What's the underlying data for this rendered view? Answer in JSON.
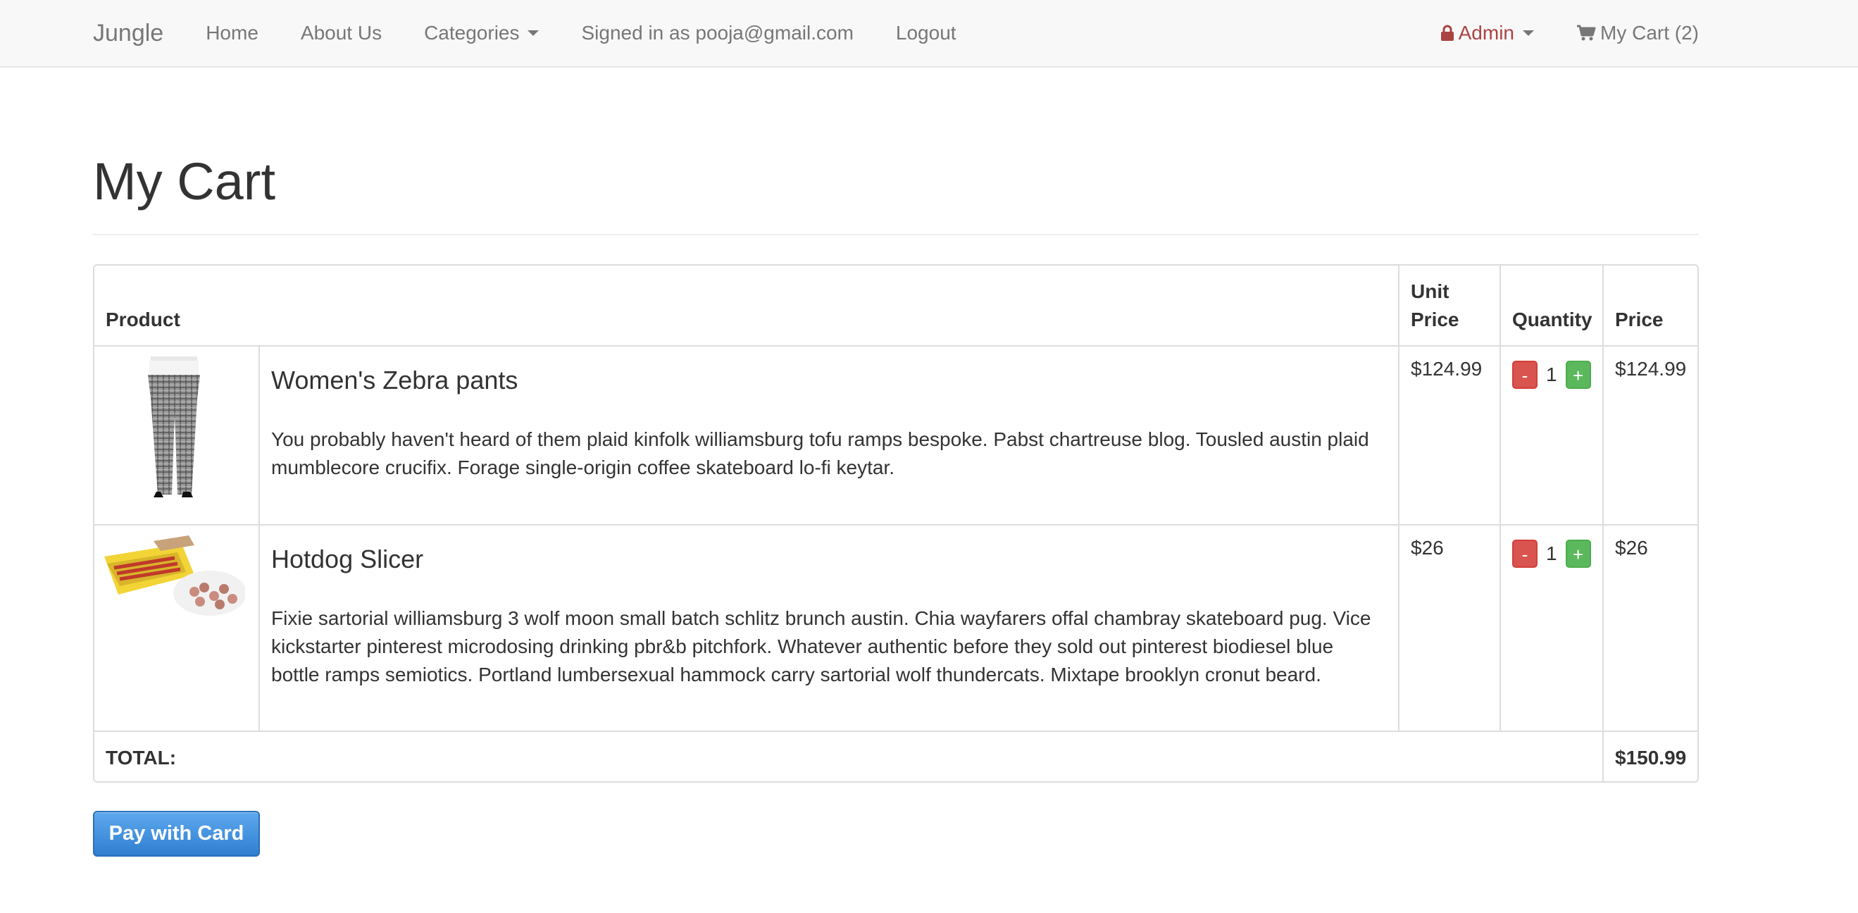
{
  "nav": {
    "brand": "Jungle",
    "home": "Home",
    "about": "About Us",
    "categories": "Categories",
    "signed_in": "Signed in as pooja@gmail.com",
    "logout": "Logout",
    "admin": "Admin",
    "cart": "My Cart (2)"
  },
  "page": {
    "title": "My Cart"
  },
  "table": {
    "headers": {
      "product": "Product",
      "unit_price": "Unit Price",
      "quantity": "Quantity",
      "price": "Price"
    },
    "items": [
      {
        "name": "Women's Zebra pants",
        "description": "You probably haven't heard of them plaid kinfolk williamsburg tofu ramps bespoke. Pabst chartreuse blog. Tousled austin plaid mumblecore crucifix. Forage single-origin coffee skateboard lo-fi keytar.",
        "unit_price": "$124.99",
        "quantity": "1",
        "price": "$124.99"
      },
      {
        "name": "Hotdog Slicer",
        "description": "Fixie sartorial williamsburg 3 wolf moon small batch schlitz brunch austin. Chia wayfarers offal chambray skateboard pug. Vice kickstarter pinterest microdosing drinking pbr&b pitchfork. Whatever authentic before they sold out pinterest biodiesel blue bottle ramps semiotics. Portland lumbersexual hammock carry sartorial wolf thundercats. Mixtape brooklyn cronut beard.",
        "unit_price": "$26",
        "quantity": "1",
        "price": "$26"
      }
    ],
    "qty_minus": "-",
    "qty_plus": "+",
    "total_label": "TOTAL:",
    "total_value": "$150.99"
  },
  "actions": {
    "pay": "Pay with Card"
  },
  "colors": {
    "admin": "#a94442",
    "pay_button": "#337ab7",
    "minus": "#d9534f",
    "plus": "#5cb85c"
  }
}
